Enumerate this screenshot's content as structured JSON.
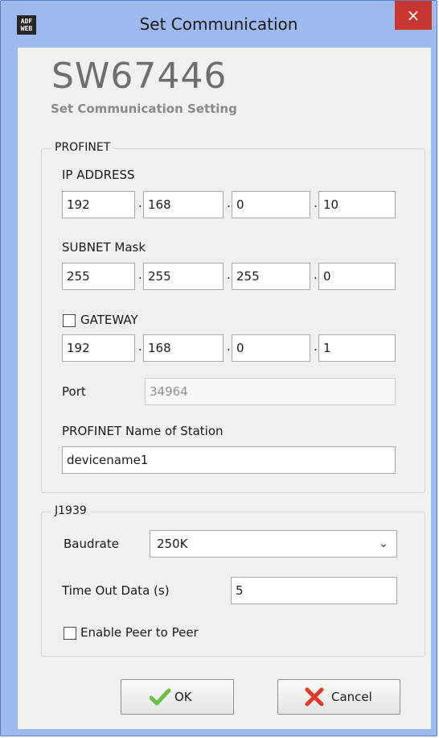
{
  "window": {
    "title": "Set Communication",
    "logo_text": "ADF WEB",
    "close_glyph": "×"
  },
  "brand": {
    "title": "SW67446",
    "subtitle": "Set Communication Setting"
  },
  "profinet": {
    "legend": "PROFINET",
    "ip_label": "IP ADDRESS",
    "ip": [
      "192",
      "168",
      "0",
      "10"
    ],
    "subnet_label": "SUBNET Mask",
    "subnet": [
      "255",
      "255",
      "255",
      "0"
    ],
    "gateway_label": "GATEWAY",
    "gateway_checked": false,
    "gateway": [
      "192",
      "168",
      "0",
      "1"
    ],
    "port_label": "Port",
    "port_value": "34964",
    "station_label": "PROFINET Name of Station",
    "station_value": "devicename1",
    "separator": "."
  },
  "j1939": {
    "legend": "J1939",
    "baudrate_label": "Baudrate",
    "baudrate_value": "250K",
    "timeout_label": "Time Out Data (s)",
    "timeout_value": "5",
    "peer_label": "Enable Peer to Peer",
    "peer_checked": false
  },
  "buttons": {
    "ok_label": "OK",
    "cancel_label": "Cancel"
  },
  "colors": {
    "frame": "#9db9ed",
    "close": "#c7372f",
    "ok_icon": "#6cc04a",
    "cancel_icon": "#e03a2e"
  }
}
